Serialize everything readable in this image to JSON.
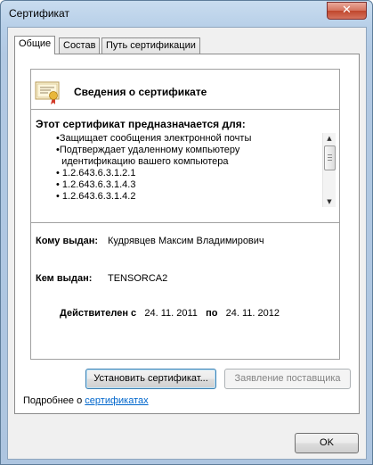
{
  "window": {
    "title": "Сертификат",
    "close_glyph": "✕"
  },
  "tabs": [
    {
      "label": "Общие",
      "active": true
    },
    {
      "label": "Состав",
      "active": false
    },
    {
      "label": "Путь сертификации",
      "active": false
    }
  ],
  "info": {
    "icon": "certificate-icon",
    "heading": "Сведения о сертификате",
    "purpose_title": "Этот сертификат предназначается для:",
    "purposes": [
      "•Защищает сообщения электронной почты",
      "•Подтверждает удаленному компьютеру",
      "  идентификацию вашего компьютера",
      "• 1.2.643.6.3.1.2.1",
      "• 1.2.643.6.3.1.4.3",
      "• 1.2.643.6.3.1.4.2"
    ],
    "issued_to_label": "Кому выдан:",
    "issued_to_value": "Кудрявцев Максим Владимирович",
    "issued_by_label": "Кем выдан:",
    "issued_by_value": "TENSORCA2",
    "valid_from_label": "Действителен с",
    "valid_from": "24. 11. 2011",
    "valid_to_label": "по",
    "valid_to": "24. 11. 2012"
  },
  "buttons": {
    "install": "Установить сертификат...",
    "issuer_statement": "Заявление поставщика",
    "ok": "OK"
  },
  "more_info": {
    "prefix": "Подробнее о ",
    "link": "сертификатах"
  },
  "colors": {
    "link": "#0066cc",
    "close_button": "#c0462c"
  }
}
